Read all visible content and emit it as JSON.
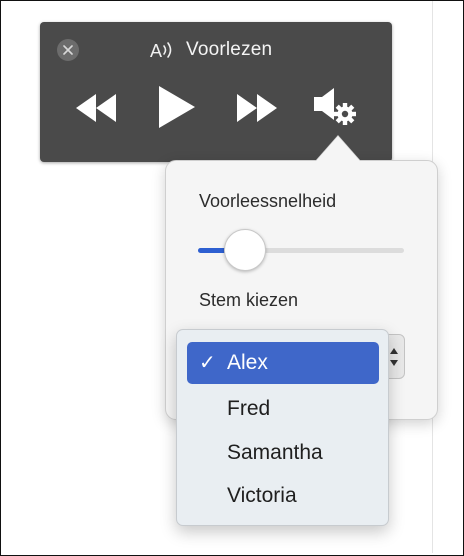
{
  "reader": {
    "title": "Voorlezen",
    "title_icon": "read-aloud-icon",
    "controls": [
      "close-icon",
      "rewind-icon",
      "play-icon",
      "fast-forward-icon",
      "speaker-settings-icon"
    ]
  },
  "settings": {
    "speed_label": "Voorleessnelheid",
    "speed_value": 0.23,
    "voice_label": "Stem kiezen",
    "selected_voice": "Alex"
  },
  "voices": [
    {
      "name": "Alex",
      "selected": true,
      "check": "✓"
    },
    {
      "name": "Fred",
      "selected": false
    },
    {
      "name": "Samantha",
      "selected": false
    },
    {
      "name": "Victoria",
      "selected": false
    }
  ],
  "colors": {
    "bar_background": "#4a4a4a",
    "accent": "#2d5fd1",
    "menu_highlight": "#3f67c9",
    "popover_background": "#f5f5f5"
  }
}
